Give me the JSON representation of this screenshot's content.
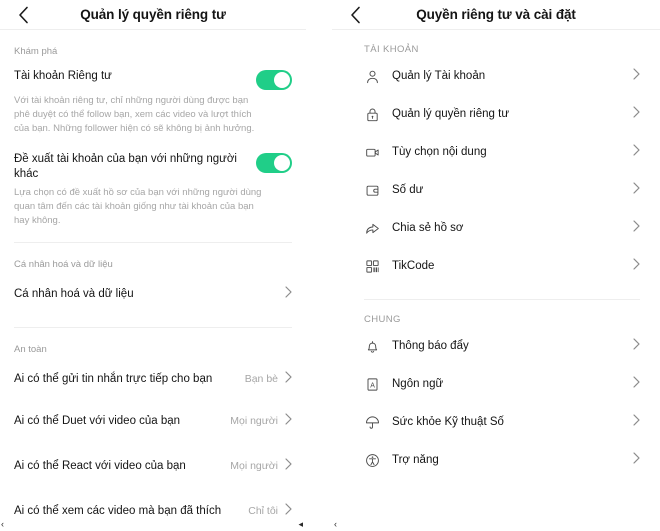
{
  "left_screen": {
    "header": {
      "title": "Quản lý quyền riêng tư",
      "back_icon": "chevron-left-icon"
    },
    "sections": [
      {
        "label": "Khám phá",
        "toggles": [
          {
            "label": "Tài khoản Riêng tư",
            "state": "on",
            "description": "Với tài khoản riêng tư, chỉ những người dùng được bạn phê duyệt có thể follow bạn, xem các video và lượt thích của bạn. Những follower hiện có sẽ không bị ảnh hưởng."
          },
          {
            "label": "Đề xuất tài khoản của bạn với những người khác",
            "state": "on",
            "description": "Lựa chọn có đề xuất hồ sơ của bạn với những người dùng quan tâm đến các tài khoản giống như tài khoản của bạn hay không."
          }
        ]
      },
      {
        "label": "Cá nhân hoá và dữ liệu",
        "rows": [
          {
            "label": "Cá nhân hoá và dữ liệu",
            "value": ""
          }
        ]
      },
      {
        "label": "An toàn",
        "rows": [
          {
            "label": "Ai có thể gửi tin nhắn trực tiếp cho bạn",
            "value": "Bạn bè"
          },
          {
            "label": "Ai có thể Duet với video của bạn",
            "value": "Mọi người"
          },
          {
            "label": "Ai có thể React với video của bạn",
            "value": "Mọi người"
          },
          {
            "label": "Ai có thể xem các video mà bạn đã thích",
            "value": "Chỉ tôi"
          }
        ]
      }
    ]
  },
  "right_screen": {
    "header": {
      "title": "Quyền riêng tư và cài đặt",
      "back_icon": "chevron-left-icon"
    },
    "sections": [
      {
        "label": "TÀI KHOẢN",
        "rows": [
          {
            "label": "Quản lý Tài khoản",
            "icon": "person-icon"
          },
          {
            "label": "Quản lý quyền riêng tư",
            "icon": "lock-icon"
          },
          {
            "label": "Tùy chọn nội dung",
            "icon": "video-camera-icon"
          },
          {
            "label": "Số dư",
            "icon": "wallet-icon"
          },
          {
            "label": "Chia sẻ hồ sơ",
            "icon": "share-arrow-icon"
          },
          {
            "label": "TikCode",
            "icon": "qr-code-icon"
          }
        ]
      },
      {
        "label": "CHUNG",
        "rows": [
          {
            "label": "Thông báo đẩy",
            "icon": "bell-icon"
          },
          {
            "label": "Ngôn ngữ",
            "icon": "language-icon"
          },
          {
            "label": "Sức khỏe Kỹ thuật Số",
            "icon": "umbrella-icon"
          },
          {
            "label": "Trợ năng",
            "icon": "accessibility-icon"
          }
        ]
      }
    ]
  },
  "colors": {
    "toggle_on": "#20ce88",
    "text_primary": "#141414",
    "text_secondary": "#a6a6a6",
    "divider": "#eeeeee"
  }
}
